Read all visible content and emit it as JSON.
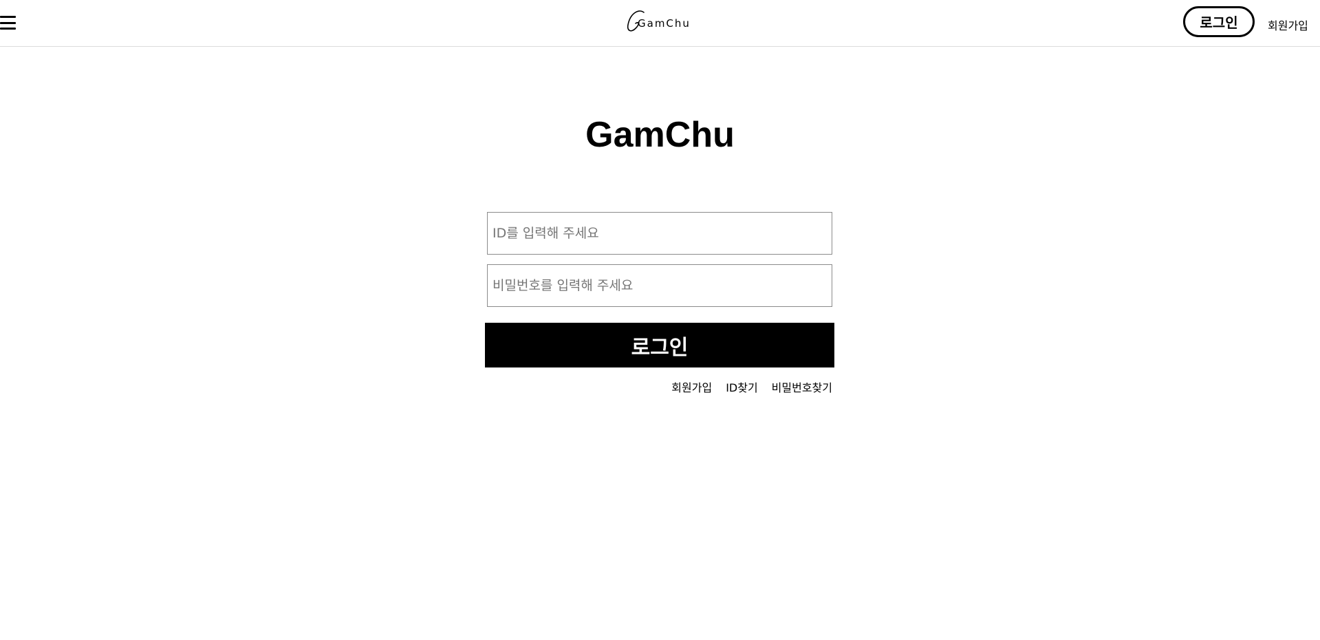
{
  "header": {
    "logo_text": "GamChu",
    "login_label": "로그인",
    "signup_label": "회원가입"
  },
  "main": {
    "title": "GamChu",
    "id_placeholder": "ID를 입력해 주세요",
    "password_placeholder": "비밀번호를 입력해 주세요",
    "submit_label": "로그인",
    "links": {
      "signup": "회원가입",
      "find_id": "ID찾기",
      "find_password": "비밀번호찾기"
    }
  },
  "icons": {
    "menu": "hamburger-menu-icon",
    "logo": "gamchu-logo-icon"
  },
  "colors": {
    "accent": "#000000",
    "background": "#ffffff"
  }
}
